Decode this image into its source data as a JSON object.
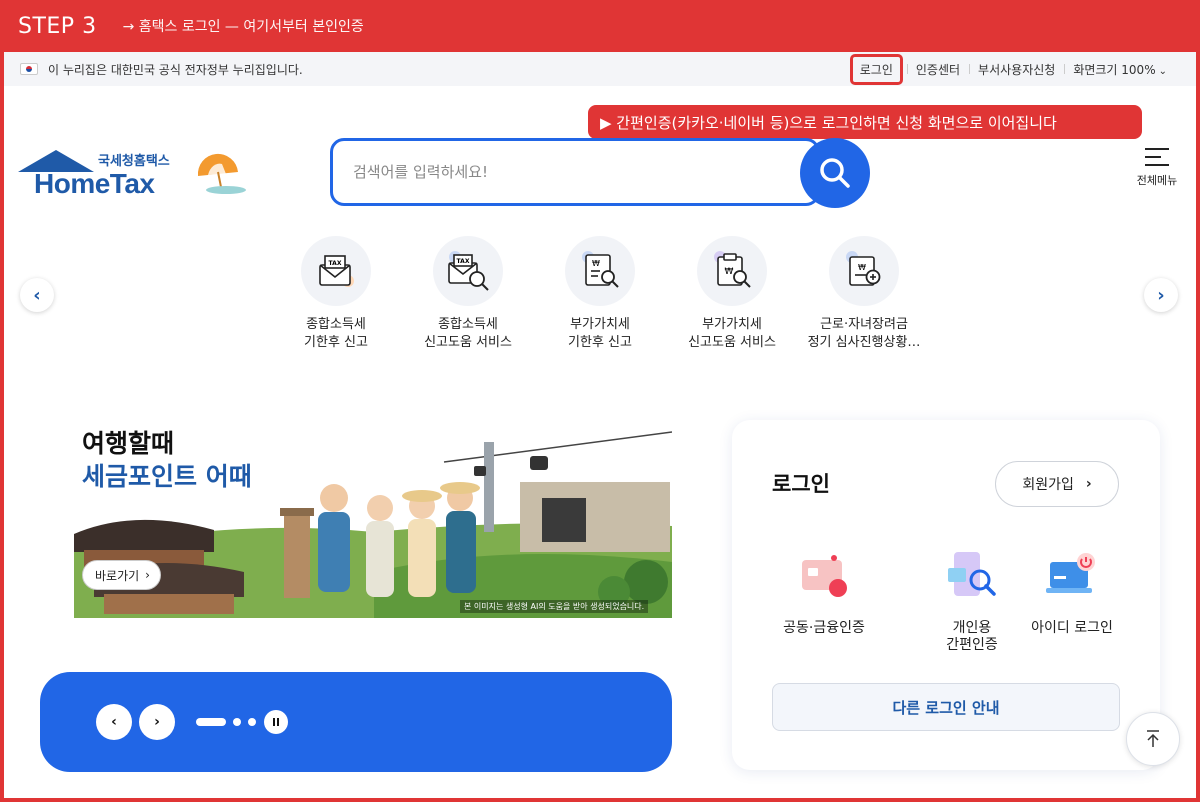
{
  "step": {
    "label": "STEP 3",
    "description": "→ 홈택스 로그인 — 여기서부터 본인인증"
  },
  "gov_bar": {
    "notice": "이 누리집은 대한민국 공식 전자정부 누리집입니다.",
    "links": {
      "login": "로그인",
      "cert_center": "인증센터",
      "dept_user": "부서사용자신청",
      "zoom": "화면크기 100%"
    }
  },
  "callout": "▶ 간편인증(카카오·네이버 등)으로 로그인하면 신청 화면으로 이어집니다",
  "header": {
    "logo_sub": "국세청홈택스",
    "logo_main": "HomeTax",
    "search_placeholder": "검색어를 입력하세요!",
    "menu_label": "전체메뉴"
  },
  "quick_menu": [
    {
      "line1": "종합소득세",
      "line2": "기한후 신고",
      "icon": "tax-envelope-icon"
    },
    {
      "line1": "종합소득세",
      "line2": "신고도움 서비스",
      "icon": "tax-search-icon"
    },
    {
      "line1": "부가가치세",
      "line2": "기한후 신고",
      "icon": "document-search-icon"
    },
    {
      "line1": "부가가치세",
      "line2": "신고도움 서비스",
      "icon": "won-clipboard-search-icon"
    },
    {
      "line1": "근로·자녀장려금",
      "line2": "정기 심사진행상황…",
      "icon": "document-plus-icon"
    }
  ],
  "banner": {
    "line1": "여행할때",
    "line2": "세금포인트 어때",
    "button": "바로가기",
    "note": "본 이미지는 생성형 AI의 도움을 받아 생성되었습니다."
  },
  "login": {
    "title": "로그인",
    "signup": "회원가입",
    "options": [
      {
        "line1": "공동·금융인증",
        "line2": "",
        "icon": "certificate-card-icon"
      },
      {
        "line1": "개인용",
        "line2": "간편인증",
        "icon": "simple-auth-phone-icon"
      },
      {
        "line1": "아이디 로그인",
        "line2": "",
        "icon": "laptop-power-icon"
      }
    ],
    "other": "다른 로그인 안내"
  },
  "colors": {
    "step_red": "#e03535",
    "brand_blue": "#1f5aa8",
    "accent_blue": "#2166e6"
  }
}
